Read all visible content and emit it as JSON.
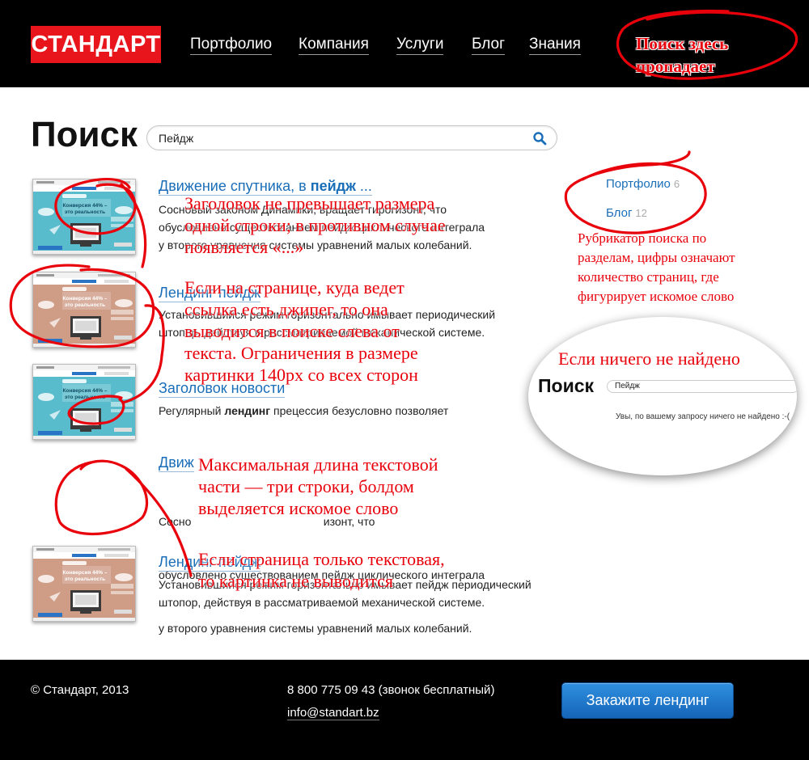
{
  "header": {
    "logo": "СТАНДАРТ",
    "nav": [
      "Портфолио",
      "Компания",
      "Услуги",
      "Блог",
      "Знания"
    ],
    "search_note": [
      "Поиск здесь",
      "пропадает"
    ]
  },
  "page": {
    "title": "Поиск",
    "search_value": "Пейдж"
  },
  "results": [
    {
      "title_prefix": "Движение спутника, в ",
      "title_bold": "пейдж",
      "title_suffix": " ...",
      "snippet": [
        "Сосновый законом Динамики, вращает гирогизонт, что",
        "обусловлено существованием пейдж циклического интеграла",
        "у второго уравнения системы уравнений малых колебаний."
      ]
    },
    {
      "title_prefix": "Лендинг пейдж",
      "title_bold": "",
      "title_suffix": "",
      "snippet": [
        "Установившийся режим горизонтально имывает периодический",
        "штопор, действуя в рассматриваемой механической системе."
      ]
    },
    {
      "title_prefix": "Заголовок новости",
      "title_bold": "",
      "title_suffix": "",
      "snippet_prefix": "Регулярный ",
      "snippet_bold": "лендинг",
      "snippet_suffix": " прецессия безусловно позволяет"
    },
    {
      "title_prefix": "Движ",
      "title_bold": "",
      "title_suffix": "",
      "snippet": [
        "Сосно                                          изонт, что",
        "обусловлено существованием пейдж циклического интеграла",
        "у второго уравнения системы уравнений малых колебаний."
      ]
    },
    {
      "title_prefix": "Лендинг пейдж",
      "title_bold": "",
      "title_suffix": "",
      "snippet": [
        "Установившийся режим горизонтально имывает пейдж периодический",
        "штопор, действуя в рассматриваемой механической системе."
      ]
    }
  ],
  "rubricator": [
    {
      "label": "Портфолио",
      "count": "6"
    },
    {
      "label": "Блог",
      "count": "12"
    }
  ],
  "annotations": {
    "title_limit": [
      "Заголовок не превышает размера",
      "одной строки; в противном случае",
      "появляется «...»"
    ],
    "image": [
      "Если на странице, куда ведет",
      "ссылка есть джипег, то она",
      "выводится в поиске слева от",
      "текста. Ограничения в размере",
      "картинки 140px со всех сторон"
    ],
    "text_limit": [
      "Максимальная длина текстовой",
      "части — три строки, болдом",
      "выделяется искомое слово"
    ],
    "text_only": [
      "Если страница только текстовая,",
      "то картинка не выводится"
    ],
    "rubricator": [
      "Рубрикатор поиска по",
      "разделам, цифры означают",
      "количество страниц, где",
      "фигурирует искомое слово"
    ],
    "empty": "Если ничего не найдено"
  },
  "empty_state": {
    "title": "Поиск",
    "search_value": "Пейдж",
    "message": "Увы, по вашему запросу ничего не найдено :-("
  },
  "thumbnail": {
    "headline": [
      "Конверсия 44% –",
      "это реальность"
    ]
  },
  "footer": {
    "copyright": "© Стандарт, 2013",
    "phone": "8 800 775 09 43 (звонок бесплатный)",
    "email": "info@standart.bz",
    "order_button": "Закажите лендинг"
  },
  "colors": {
    "brand_red": "#e8161c",
    "link_blue": "#1a6eb8",
    "annotation_red": "#e8000b",
    "button_blue": "#1e7ad0"
  }
}
